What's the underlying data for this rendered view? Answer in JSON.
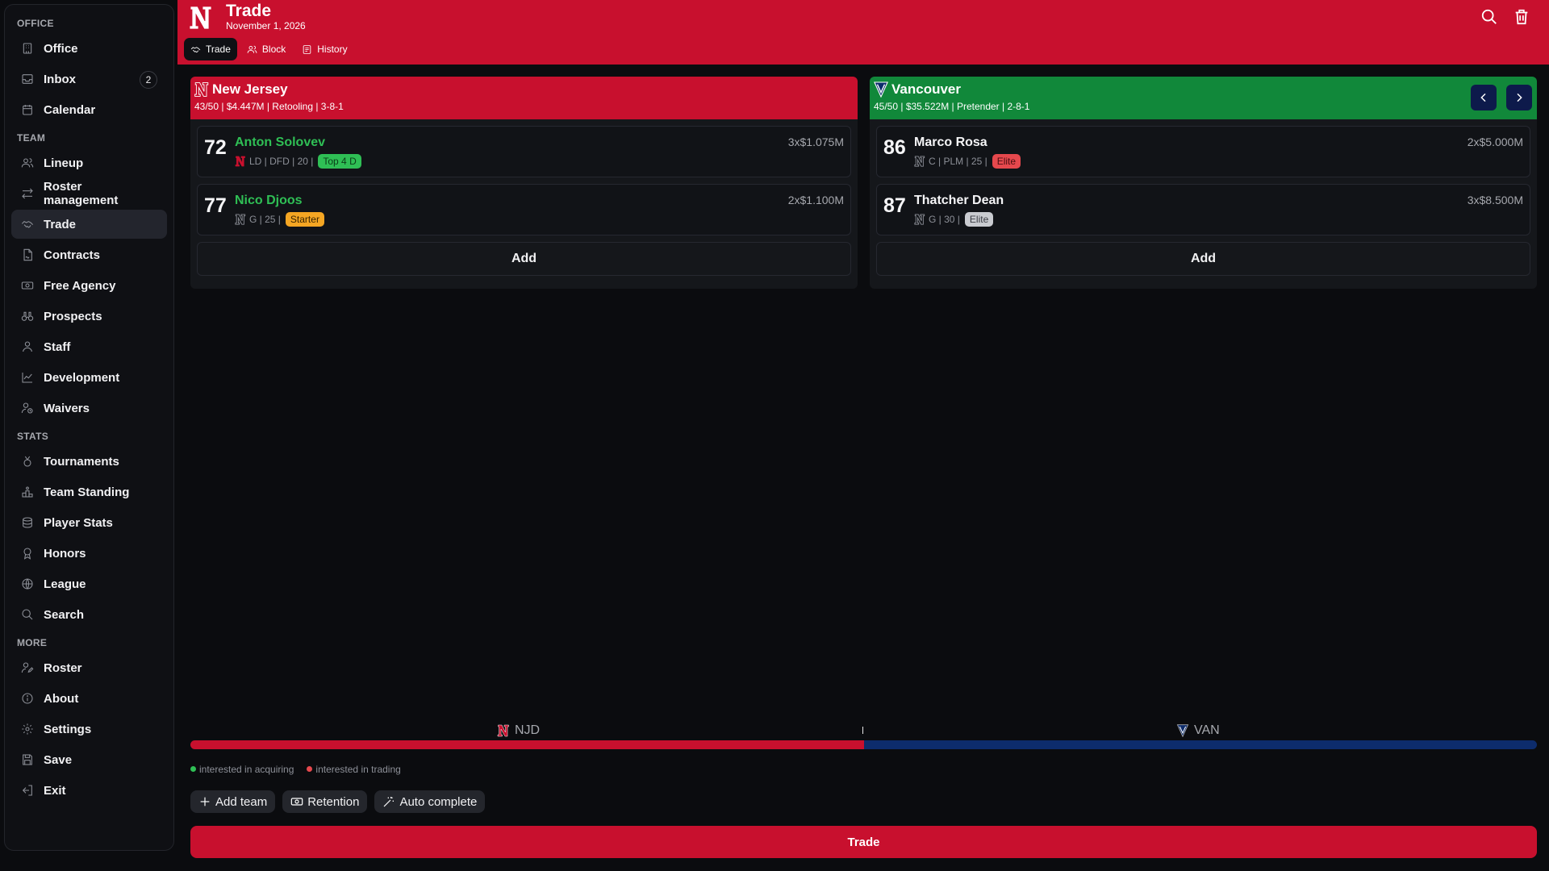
{
  "colors": {
    "accent": "#c8102e",
    "vancouver": "#11883a",
    "vancouver_navy": "#0d2c6c",
    "green_text": "#2fbf55"
  },
  "sidebar": {
    "sections": [
      {
        "title": "OFFICE",
        "items": [
          {
            "label": "Office",
            "icon": "building-icon"
          },
          {
            "label": "Inbox",
            "icon": "inbox-icon",
            "badge": "2"
          },
          {
            "label": "Calendar",
            "icon": "calendar-icon"
          }
        ]
      },
      {
        "title": "TEAM",
        "items": [
          {
            "label": "Lineup",
            "icon": "users-icon"
          },
          {
            "label": "Roster management",
            "icon": "arrows-icon"
          },
          {
            "label": "Trade",
            "icon": "handshake-icon",
            "active": true
          },
          {
            "label": "Contracts",
            "icon": "contract-icon"
          },
          {
            "label": "Free Agency",
            "icon": "money-icon"
          },
          {
            "label": "Prospects",
            "icon": "binoculars-icon"
          },
          {
            "label": "Staff",
            "icon": "person-icon"
          },
          {
            "label": "Development",
            "icon": "chart-icon"
          },
          {
            "label": "Waivers",
            "icon": "user-clock-icon"
          }
        ]
      },
      {
        "title": "STATS",
        "items": [
          {
            "label": "Tournaments",
            "icon": "medal-icon"
          },
          {
            "label": "Team Standing",
            "icon": "podium-icon"
          },
          {
            "label": "Player Stats",
            "icon": "database-icon"
          },
          {
            "label": "Honors",
            "icon": "award-icon"
          },
          {
            "label": "League",
            "icon": "globe-icon"
          },
          {
            "label": "Search",
            "icon": "search-icon"
          }
        ]
      },
      {
        "title": "MORE",
        "items": [
          {
            "label": "Roster",
            "icon": "user-edit-icon"
          },
          {
            "label": "About",
            "icon": "info-icon"
          },
          {
            "label": "Settings",
            "icon": "gear-icon"
          },
          {
            "label": "Save",
            "icon": "save-icon"
          },
          {
            "label": "Exit",
            "icon": "exit-icon"
          }
        ]
      }
    ]
  },
  "header": {
    "title": "Trade",
    "date": "November 1, 2026",
    "tabs": [
      {
        "label": "Trade",
        "icon": "handshake-icon",
        "active": true
      },
      {
        "label": "Block",
        "icon": "users-icon"
      },
      {
        "label": "History",
        "icon": "history-icon"
      }
    ]
  },
  "teams": {
    "left": {
      "name": "New Jersey",
      "meta": "43/50 | $4.447M | Retooling | 3-8-1",
      "add_label": "Add",
      "players": [
        {
          "ovr": "72",
          "name": "Anton Solovev",
          "info": "LD | DFD | 20 |",
          "tag": "Top 4 D",
          "tag_bg": "#2fbf55",
          "tag_fg": "#0b3d18",
          "contract": "3x$1.075M",
          "name_color": "green"
        },
        {
          "ovr": "77",
          "name": "Nico Djoos",
          "info": "G | 25 |",
          "tag": "Starter",
          "tag_bg": "#f5a623",
          "tag_fg": "#3a2400",
          "contract": "2x$1.100M",
          "name_color": "green"
        }
      ]
    },
    "right": {
      "name": "Vancouver",
      "meta": "45/50 | $35.522M | Pretender | 2-8-1",
      "add_label": "Add",
      "players": [
        {
          "ovr": "86",
          "name": "Marco Rosa",
          "info": "C | PLM | 25 |",
          "tag": "Elite",
          "tag_bg": "#e5484d",
          "tag_fg": "#4a0d10",
          "contract": "2x$5.000M",
          "name_color": "white"
        },
        {
          "ovr": "87",
          "name": "Thatcher Dean",
          "info": "G | 30 |",
          "tag": "Elite",
          "tag_bg": "#c9cbd0",
          "tag_fg": "#3a3c43",
          "contract": "3x$8.500M",
          "name_color": "white"
        }
      ]
    }
  },
  "balance": {
    "left_abbr": "NJD",
    "right_abbr": "VAN",
    "left_fraction": 0.5
  },
  "legend": {
    "acquire": "interested in acquiring",
    "trading": "interested in trading",
    "acquire_color": "#2fbf55",
    "trading_color": "#e5484d"
  },
  "actions": [
    {
      "label": "Add team",
      "icon": "plus-icon"
    },
    {
      "label": "Retention",
      "icon": "money-icon"
    },
    {
      "label": "Auto complete",
      "icon": "wand-icon"
    }
  ],
  "trade_button": "Trade"
}
